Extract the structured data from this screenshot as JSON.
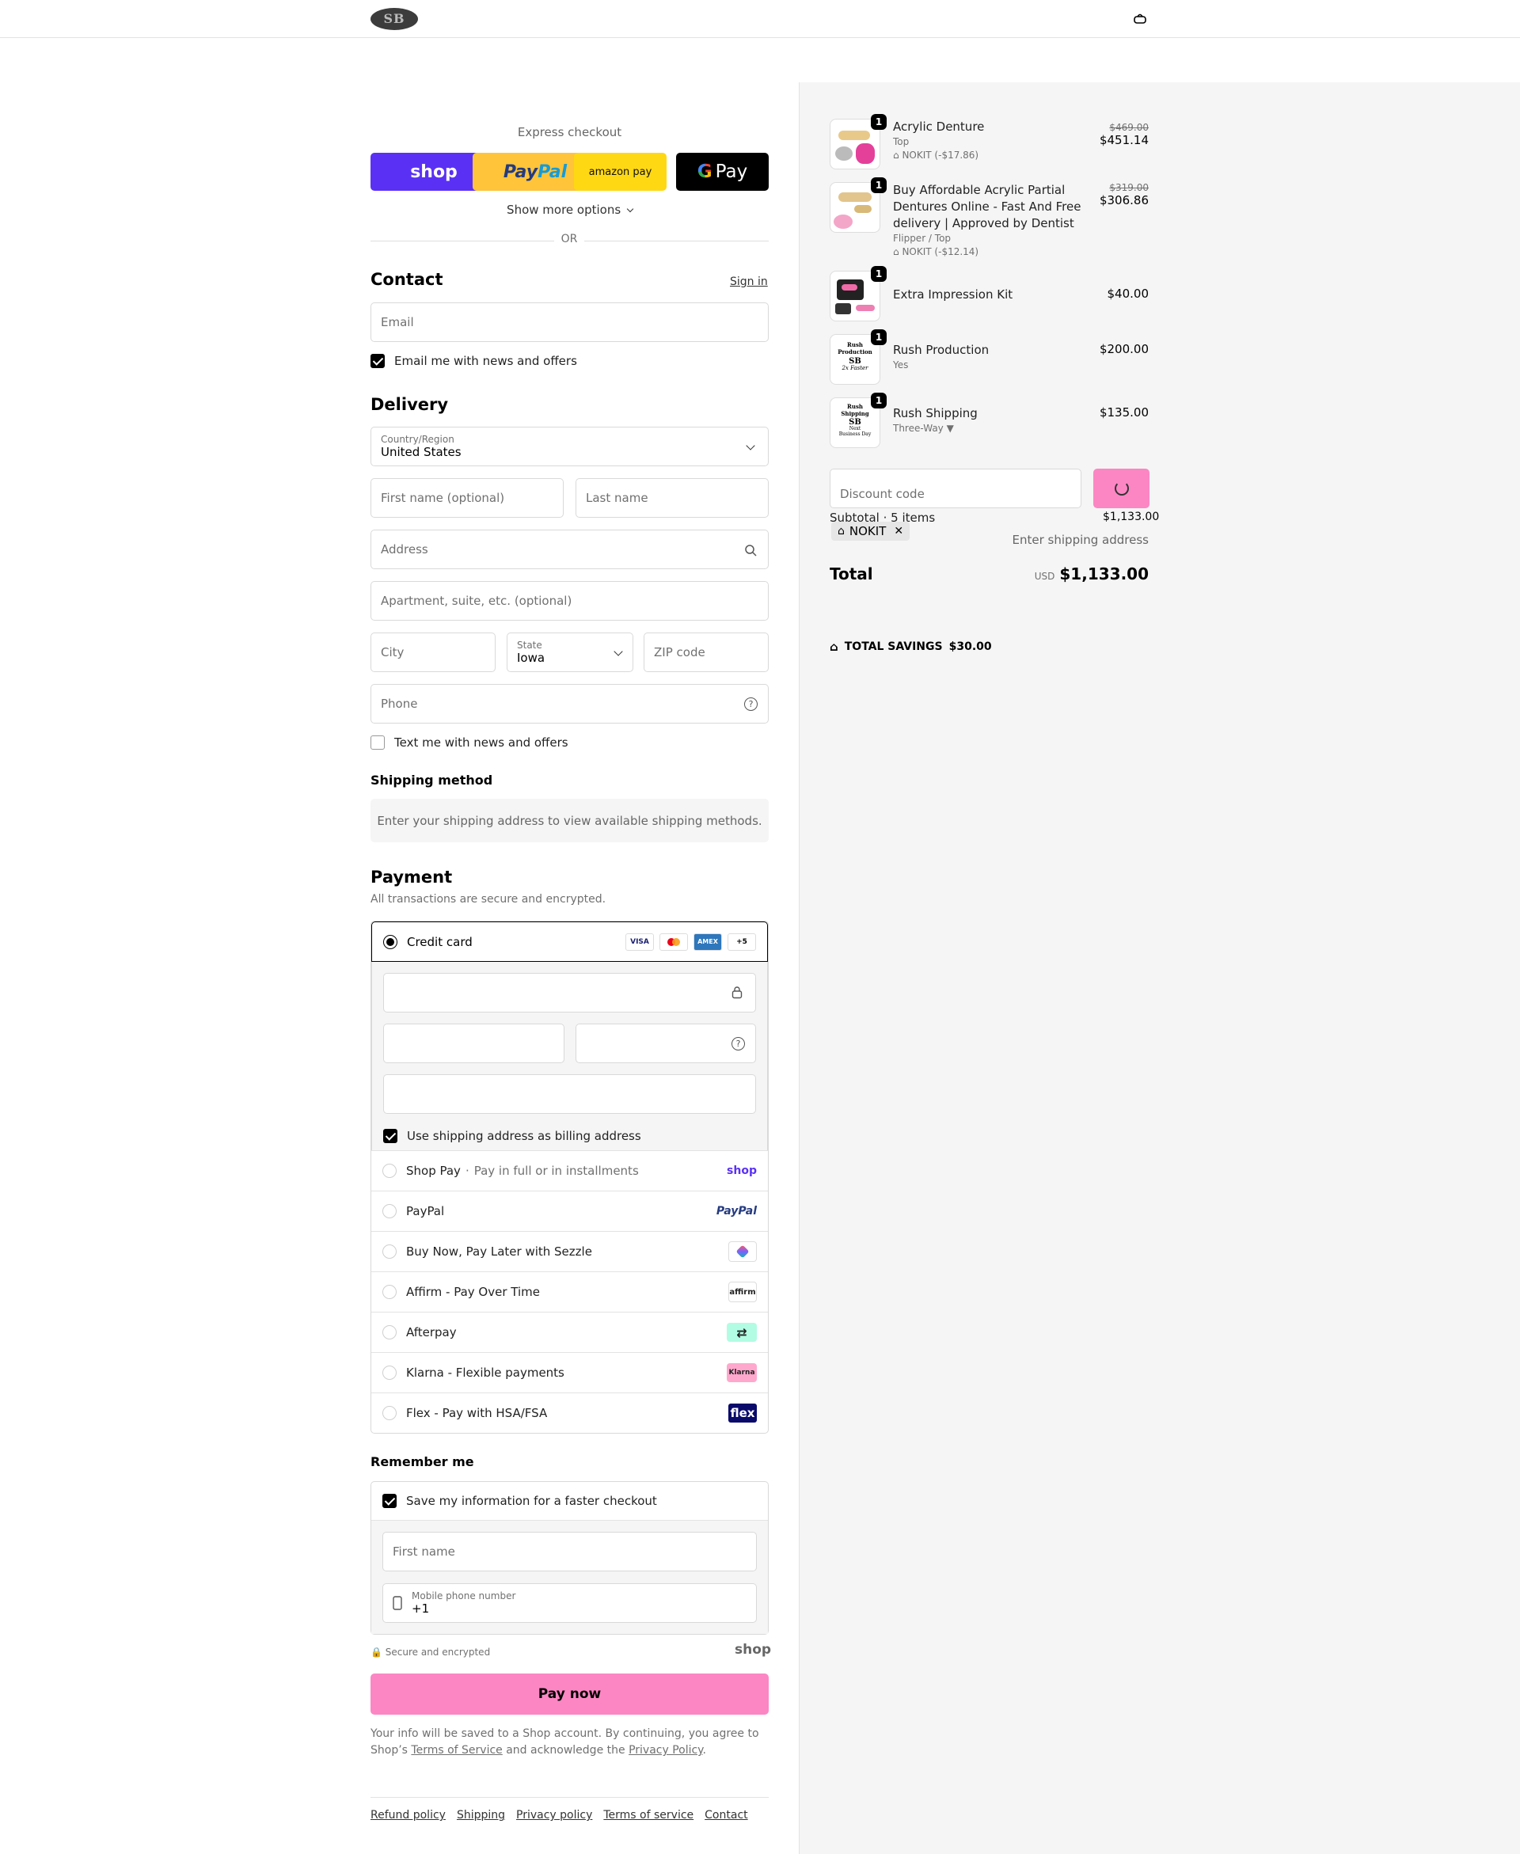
{
  "header": {
    "logo": "SB",
    "bag_icon": "bag-icon"
  },
  "express": {
    "title": "Express checkout",
    "shop_label": "shop",
    "paypal_a": "Pay",
    "paypal_b": "Pal",
    "amazon_label": "amazon pay",
    "gpay_g": "G",
    "gpay_label": "Pay",
    "more_options": "Show more options",
    "or": "OR"
  },
  "contact": {
    "title": "Contact",
    "sign_in": "Sign in",
    "email_placeholder": "Email",
    "news_label": "Email me with news and offers",
    "news_checked": true
  },
  "delivery": {
    "title": "Delivery",
    "country_label": "Country/Region",
    "country_value": "United States",
    "first_name": "First name (optional)",
    "last_name": "Last name",
    "address": "Address",
    "apartment": "Apartment, suite, etc. (optional)",
    "city": "City",
    "state_label": "State",
    "state_value": "Iowa",
    "zip": "ZIP code",
    "phone": "Phone",
    "text_label": "Text me with news and offers",
    "text_checked": false
  },
  "shipping_method": {
    "title": "Shipping method",
    "note": "Enter your shipping address to view available shipping methods."
  },
  "payment": {
    "title": "Payment",
    "subtitle": "All transactions are secure and encrypted.",
    "credit_card": "Credit card",
    "cards": [
      "VISA",
      "MC",
      "AMEX",
      "+5"
    ],
    "billing_label": "Use shipping address as billing address",
    "methods": [
      {
        "label": "Shop Pay",
        "sub": "Pay in full or in installments",
        "logo": "shop"
      },
      {
        "label": "PayPal",
        "sub": "",
        "logo": "PayPal"
      },
      {
        "label": "Buy Now, Pay Later with Sezzle",
        "sub": "",
        "logo": "sezzle-icon"
      },
      {
        "label": "Affirm - Pay Over Time",
        "sub": "",
        "logo": "affirm"
      },
      {
        "label": "Afterpay",
        "sub": "",
        "logo": "afterpay-icon"
      },
      {
        "label": "Klarna - Flexible payments",
        "sub": "",
        "logo": "Klarna"
      },
      {
        "label": "Flex - Pay with HSA/FSA",
        "sub": "",
        "logo": "flex"
      }
    ]
  },
  "remember": {
    "title": "Remember me",
    "save_label": "Save my information for a faster checkout",
    "first_name": "First name",
    "mobile_label": "Mobile phone number",
    "mobile_value": "+1",
    "secure": "Secure and encrypted",
    "shop_mark": "shop"
  },
  "pay_now": "Pay now",
  "legal": {
    "text_a": "Your info will be saved to a Shop account. By continuing, you agree to Shop’s ",
    "tos": "Terms of Service",
    "text_b": " and acknowledge the ",
    "privacy": "Privacy Policy",
    "text_c": "."
  },
  "footer": [
    "Refund policy",
    "Shipping",
    "Privacy policy",
    "Terms of service",
    "Contact"
  ],
  "summary": {
    "items": [
      {
        "qty": "1",
        "name": "Acrylic Denture",
        "variant": "Top",
        "discount": "NOKIT (-$17.86)",
        "old_price": "$469.00",
        "price": "$451.14"
      },
      {
        "qty": "1",
        "name": "Buy Affordable Acrylic Partial Dentures Online - Fast And Free delivery | Approved by Dentist",
        "variant": "Flipper / Top",
        "discount": "NOKIT (-$12.14)",
        "old_price": "$319.00",
        "price": "$306.86"
      },
      {
        "qty": "1",
        "name": "Extra Impression Kit",
        "variant": "",
        "discount": "",
        "old_price": "",
        "price": "$40.00"
      },
      {
        "qty": "1",
        "name": "Rush Production",
        "variant": "Yes",
        "discount": "",
        "old_price": "",
        "price": "$200.00",
        "thumb": "Rush Production SB 2x Faster"
      },
      {
        "qty": "1",
        "name": "Rush Shipping",
        "variant": "Three-Way ▼",
        "discount": "",
        "old_price": "",
        "price": "$135.00",
        "thumb": "Rush Shipping SB Next Business Day"
      }
    ],
    "discount_placeholder": "Discount code",
    "subtotal_label": "Subtotal · 5 items",
    "subtotal_value": "$1,133.00",
    "code_tag": "NOKIT",
    "shipping_value": "Enter shipping address",
    "total_label": "Total",
    "currency": "USD",
    "total_value": "$1,133.00",
    "savings_label": "TOTAL SAVINGS",
    "savings_value": "$30.00"
  }
}
